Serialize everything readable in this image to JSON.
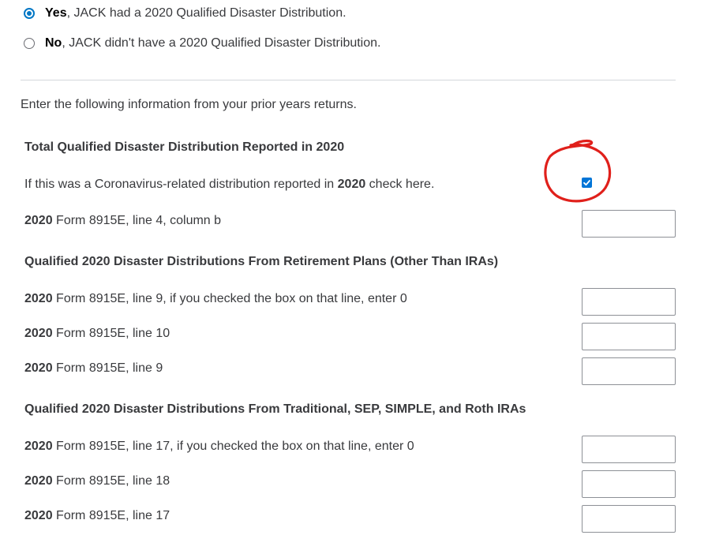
{
  "radio_group": {
    "yes": {
      "strong": "Yes",
      "text": ", JACK had a 2020 Qualified Disaster Distribution.",
      "checked": true
    },
    "no": {
      "strong": "No",
      "text": ", JACK didn't have a 2020 Qualified Disaster Distribution.",
      "checked": false
    }
  },
  "intro_text": "Enter the following information from your prior years returns.",
  "section_total": {
    "heading": "Total Qualified Disaster Distribution Reported in 2020",
    "checkbox_label_pre": "If this was a Coronavirus-related distribution reported in ",
    "checkbox_label_year": "2020",
    "checkbox_label_post": " check here.",
    "checkbox_checked": true,
    "field": {
      "year": "2020",
      "label": " Form 8915E, line 4, column b",
      "value": ""
    }
  },
  "section_retirement": {
    "heading": "Qualified 2020 Disaster Distributions From Retirement Plans (Other Than IRAs)",
    "fields": [
      {
        "year": "2020",
        "label": " Form 8915E, line 9, if you checked the box on that line, enter 0",
        "value": ""
      },
      {
        "year": "2020",
        "label": " Form 8915E, line 10",
        "value": ""
      },
      {
        "year": "2020",
        "label": " Form 8915E, line 9",
        "value": ""
      }
    ]
  },
  "section_ira": {
    "heading": "Qualified 2020 Disaster Distributions From Traditional, SEP, SIMPLE, and Roth IRAs",
    "fields": [
      {
        "year": "2020",
        "label": " Form 8915E, line 17, if you checked the box on that line, enter 0",
        "value": ""
      },
      {
        "year": "2020",
        "label": " Form 8915E, line 18",
        "value": ""
      },
      {
        "year": "2020",
        "label": " Form 8915E, line 17",
        "value": ""
      }
    ]
  },
  "colors": {
    "accent": "#0077c5",
    "checkbox": "#0075d7",
    "annotation": "#e0201b",
    "divider": "#d4d7dc",
    "text": "#393a3d"
  }
}
